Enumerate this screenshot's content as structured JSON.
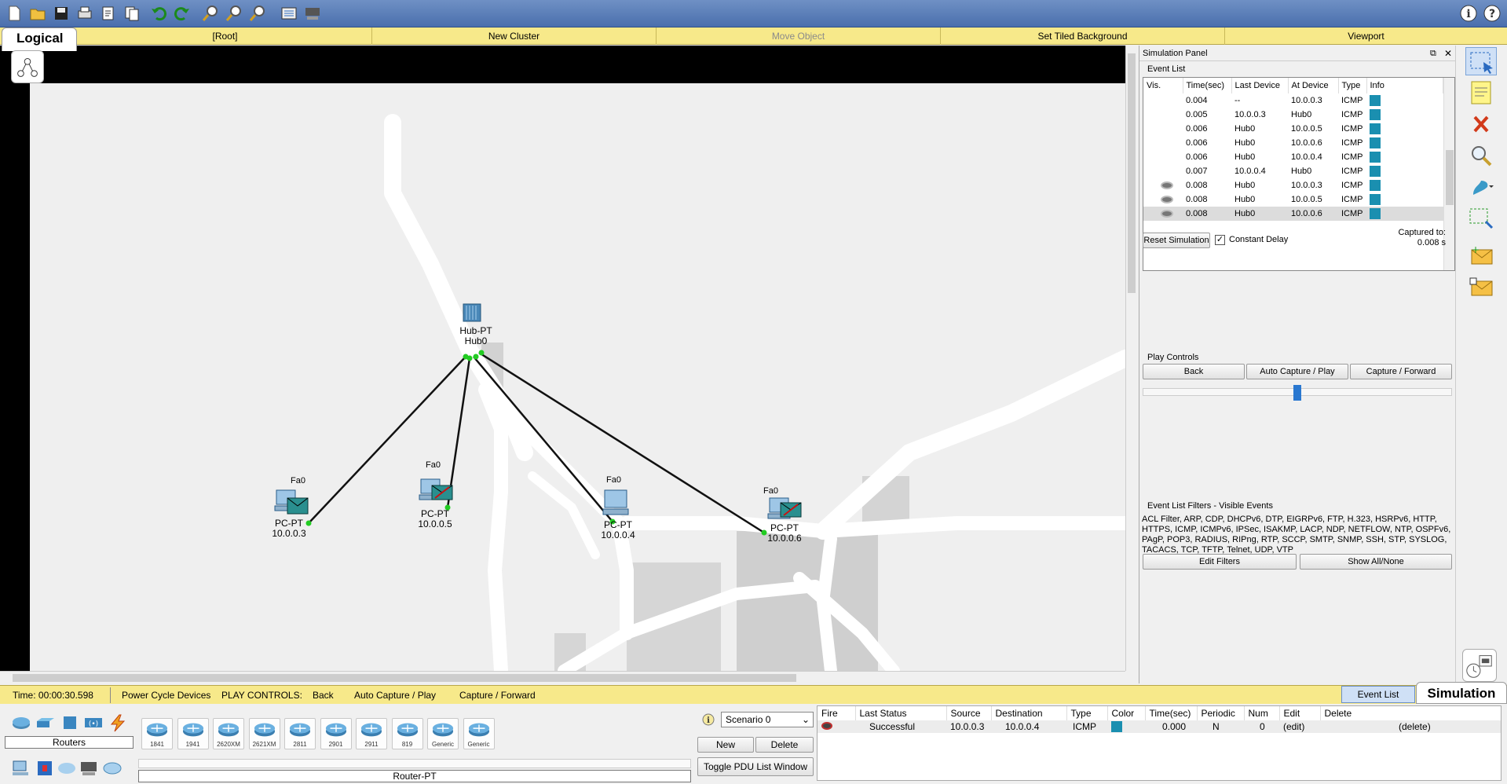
{
  "nav": {
    "logical_tab": "Logical",
    "items": [
      "[Root]",
      "New Cluster",
      "Move Object",
      "Set Tiled Background",
      "Viewport"
    ]
  },
  "devices": {
    "hub": {
      "line1": "Hub-PT",
      "line2": "Hub0"
    },
    "pc3": {
      "model": "PC-PT",
      "ip": "10.0.0.3",
      "port": "Fa0"
    },
    "pc5": {
      "model": "PC-PT",
      "ip": "10.0.0.5",
      "port": "Fa0"
    },
    "pc4": {
      "model": "PC-PT",
      "ip": "10.0.0.4",
      "port": "Fa0"
    },
    "pc6": {
      "model": "PC-PT",
      "ip": "10.0.0.6",
      "port": "Fa0"
    }
  },
  "sim": {
    "title": "Simulation Panel",
    "event_list_label": "Event List",
    "columns": [
      "Vis.",
      "Time(sec)",
      "Last Device",
      "At Device",
      "Type",
      "Info"
    ],
    "events": [
      {
        "vis": "",
        "time": "0.004",
        "last": "--",
        "at": "10.0.0.3",
        "type": "ICMP"
      },
      {
        "vis": "",
        "time": "0.005",
        "last": "10.0.0.3",
        "at": "Hub0",
        "type": "ICMP"
      },
      {
        "vis": "",
        "time": "0.006",
        "last": "Hub0",
        "at": "10.0.0.5",
        "type": "ICMP"
      },
      {
        "vis": "",
        "time": "0.006",
        "last": "Hub0",
        "at": "10.0.0.6",
        "type": "ICMP"
      },
      {
        "vis": "",
        "time": "0.006",
        "last": "Hub0",
        "at": "10.0.0.4",
        "type": "ICMP"
      },
      {
        "vis": "",
        "time": "0.007",
        "last": "10.0.0.4",
        "at": "Hub0",
        "type": "ICMP"
      },
      {
        "vis": "eye",
        "time": "0.008",
        "last": "Hub0",
        "at": "10.0.0.3",
        "type": "ICMP"
      },
      {
        "vis": "eye",
        "time": "0.008",
        "last": "Hub0",
        "at": "10.0.0.5",
        "type": "ICMP"
      },
      {
        "vis": "eye",
        "time": "0.008",
        "last": "Hub0",
        "at": "10.0.0.6",
        "type": "ICMP"
      }
    ],
    "reset_label": "Reset Simulation",
    "constant_delay_label": "Constant Delay",
    "captured_to_label": "Captured to:",
    "captured_to_value": "0.008 s",
    "play_controls_label": "Play Controls",
    "back_label": "Back",
    "auto_capture_label": "Auto Capture / Play",
    "capture_forward_label": "Capture / Forward",
    "filters_label": "Event List Filters - Visible Events",
    "filters_text": "ACL Filter, ARP, CDP, DHCPv6, DTP, EIGRPv6, FTP, H.323, HSRPv6, HTTP, HTTPS, ICMP, ICMPv6, IPSec, ISAKMP, LACP, NDP, NETFLOW, NTP, OSPFv6, PAgP, POP3, RADIUS, RIPng, RTP, SCCP, SMTP, SNMP, SSH, STP, SYSLOG, TACACS, TCP, TFTP, Telnet, UDP, VTP",
    "edit_filters_label": "Edit Filters",
    "show_all_label": "Show All/None"
  },
  "status": {
    "time": "Time: 00:00:30.598",
    "power_cycle": "Power Cycle Devices",
    "play_controls": "PLAY CONTROLS:",
    "back": "Back",
    "auto_capture": "Auto Capture / Play",
    "capture_forward": "Capture / Forward",
    "event_list": "Event List",
    "simulation": "Simulation"
  },
  "bottom": {
    "category_label": "Routers",
    "router_models": [
      "1841",
      "1941",
      "2620XM",
      "2621XM",
      "2811",
      "2901",
      "2911",
      "819",
      "Generic",
      "Generic"
    ],
    "strip_label": "Router-PT",
    "scenario": "Scenario 0",
    "new_label": "New",
    "delete_label": "Delete",
    "toggle_pdu_label": "Toggle PDU List Window",
    "pdu_columns": [
      "Fire",
      "Last Status",
      "Source",
      "Destination",
      "Type",
      "Color",
      "Time(sec)",
      "Periodic",
      "Num",
      "Edit",
      "Delete"
    ],
    "pdu_row": {
      "status": "Successful",
      "source": "10.0.0.3",
      "destination": "10.0.0.4",
      "type": "ICMP",
      "time": "0.000",
      "periodic": "N",
      "num": "0",
      "edit": "(edit)",
      "delete": "(delete)"
    }
  },
  "colors": {
    "pdu_swatch": "#1a8fb0",
    "link_up": "#22cc22",
    "nav_bg": "#f7e98a"
  }
}
